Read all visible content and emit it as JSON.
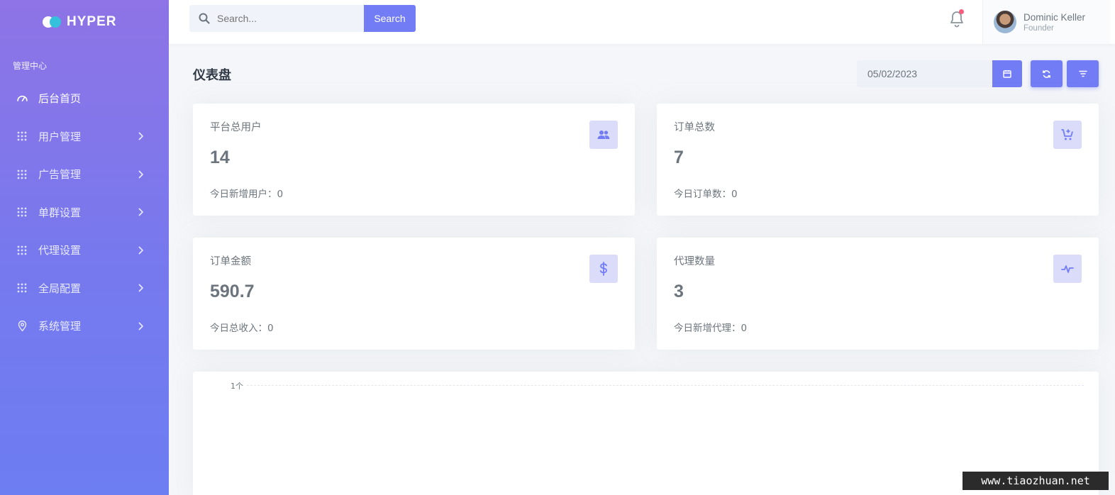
{
  "brand": {
    "name": "HYPER"
  },
  "sidebar": {
    "section_title": "管理中心",
    "items": [
      {
        "label": "后台首页",
        "icon": "speedometer-icon",
        "has_chevron": false
      },
      {
        "label": "用户管理",
        "icon": "grid-dots-icon",
        "has_chevron": true
      },
      {
        "label": "广告管理",
        "icon": "grid-dots-icon",
        "has_chevron": true
      },
      {
        "label": "单群设置",
        "icon": "grid-dots-icon",
        "has_chevron": true
      },
      {
        "label": "代理设置",
        "icon": "grid-dots-icon",
        "has_chevron": true
      },
      {
        "label": "全局配置",
        "icon": "grid-dots-icon",
        "has_chevron": true
      },
      {
        "label": "系统管理",
        "icon": "map-pin-icon",
        "has_chevron": true
      }
    ]
  },
  "topbar": {
    "search": {
      "placeholder": "Search...",
      "button_label": "Search"
    },
    "user": {
      "name": "Dominic Keller",
      "role": "Founder"
    }
  },
  "page": {
    "title": "仪表盘",
    "date_value": "05/02/2023"
  },
  "stats": [
    {
      "label": "平台总用户",
      "value": "14",
      "sub": "今日新增用户：0",
      "icon": "users-icon"
    },
    {
      "label": "订单总数",
      "value": "7",
      "sub": "今日订单数：0",
      "icon": "cart-plus-icon"
    },
    {
      "label": "订单金额",
      "value": "590.7",
      "sub": "今日总收入：0",
      "icon": "dollar-icon"
    },
    {
      "label": "代理数量",
      "value": "3",
      "sub": "今日新增代理：0",
      "icon": "pulse-icon"
    }
  ],
  "chart_data": {
    "type": "line",
    "y_ticks": [
      "1个"
    ],
    "series": []
  },
  "watermark": "www.tiaozhuan.net",
  "colors": {
    "primary": "#727cf5",
    "sidebar_top": "#8e74e6",
    "sidebar_bottom": "#6d7df2",
    "icon_bg": "#dadcfa",
    "notification_dot": "#fa5c7c"
  }
}
